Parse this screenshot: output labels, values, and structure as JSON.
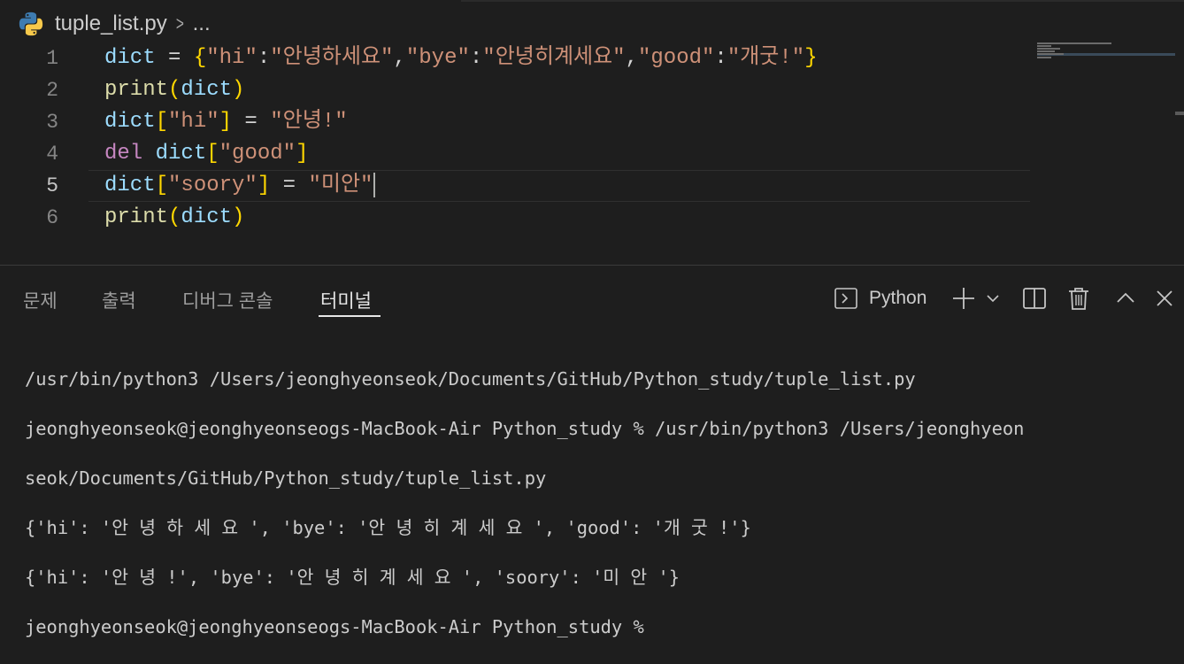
{
  "breadcrumb": {
    "file": "tuple_list.py",
    "separator": ">",
    "more": "..."
  },
  "editor": {
    "lines": [
      {
        "number": "1"
      },
      {
        "number": "2"
      },
      {
        "number": "3"
      },
      {
        "number": "4"
      },
      {
        "number": "5"
      },
      {
        "number": "6"
      }
    ],
    "line1": {
      "var": "dict",
      "eq": " = ",
      "open": "{",
      "k1": "\"hi\"",
      "c1": ":",
      "v1": "\"안녕하세요\"",
      "comma1": ",",
      "k2": "\"bye\"",
      "c2": ":",
      "v2": "\"안녕히계세요\"",
      "comma2": ",",
      "k3": "\"good\"",
      "c3": ":",
      "v3": "\"개굿!\"",
      "close": "}"
    },
    "line2": {
      "fn": "print",
      "open": "(",
      "arg": "dict",
      "close": ")"
    },
    "line3": {
      "var": "dict",
      "open": "[",
      "key": "\"hi\"",
      "close": "]",
      "eq": " = ",
      "val": "\"안녕!\""
    },
    "line4": {
      "kw": "del",
      "sp": " ",
      "var": "dict",
      "open": "[",
      "key": "\"good\"",
      "close": "]"
    },
    "line5": {
      "var": "dict",
      "open": "[",
      "key": "\"soory\"",
      "close": "]",
      "eq": " = ",
      "val": "\"미안\""
    },
    "line6": {
      "fn": "print",
      "open": "(",
      "arg": "dict",
      "close": ")"
    },
    "current_line": "5"
  },
  "panel": {
    "tabs": [
      {
        "label": "문제"
      },
      {
        "label": "출력"
      },
      {
        "label": "디버그 콘솔"
      },
      {
        "label": "터미널"
      }
    ],
    "active_tab": "터미널",
    "terminal_profile": "Python",
    "icons": {
      "terminal": "terminal-icon",
      "add": "plus-icon",
      "dropdown": "chevron-down-icon",
      "split": "split-icon",
      "trash": "trash-icon",
      "maximize": "chevron-up-icon",
      "close": "close-icon"
    }
  },
  "terminal": {
    "lines": [
      "/usr/bin/python3 /Users/jeonghyeonseok/Documents/GitHub/Python_study/tuple_list.py",
      "jeonghyeonseok@jeonghyeonseogs-MacBook-Air Python_study % /usr/bin/python3 /Users/jeonghyeon",
      "seok/Documents/GitHub/Python_study/tuple_list.py",
      "{'hi': '안 녕 하 세 요 ', 'bye': '안 녕 히 계 세 요 ', 'good': '개 굿 !'}",
      "{'hi': '안 녕 !', 'bye': '안 녕 히 계 세 요 ', 'soory': '미 안 '}",
      "jeonghyeonseok@jeonghyeonseogs-MacBook-Air Python_study % "
    ]
  },
  "colors": {
    "background": "#1e1e1e",
    "variable": "#9cdcfe",
    "function": "#dcdcaa",
    "keyword": "#c586c0",
    "string": "#ce9178",
    "bracket_level1": "#ffd700",
    "bracket_level2": "#da70d6"
  }
}
